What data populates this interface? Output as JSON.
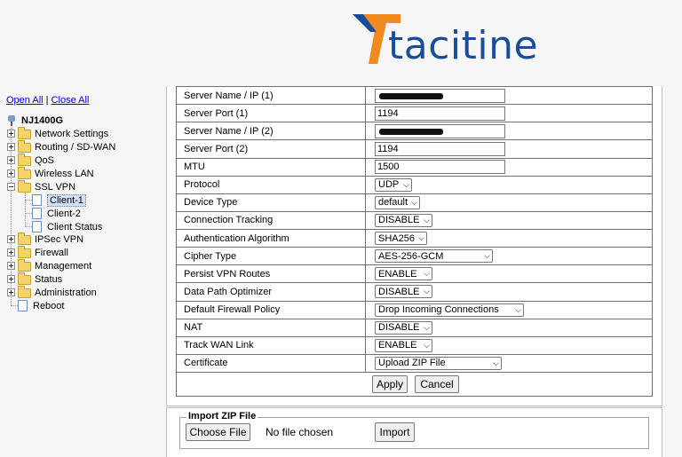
{
  "brand": {
    "name": "tacitine",
    "colors": {
      "orange": "#f08a1e",
      "blue": "#1a4d99"
    }
  },
  "sidebar": {
    "open_all": "Open All",
    "separator": "|",
    "close_all": "Close All",
    "root": "NJ1400G",
    "items": [
      {
        "label": "Network Settings"
      },
      {
        "label": "Routing / SD-WAN"
      },
      {
        "label": "QoS"
      },
      {
        "label": "Wireless LAN"
      },
      {
        "label": "SSL VPN"
      },
      {
        "label": "Client-1"
      },
      {
        "label": "Client-2"
      },
      {
        "label": "Client Status"
      },
      {
        "label": "IPSec VPN"
      },
      {
        "label": "Firewall"
      },
      {
        "label": "Management"
      },
      {
        "label": "Status"
      },
      {
        "label": "Administration"
      },
      {
        "label": "Reboot"
      }
    ]
  },
  "form": {
    "rows": [
      {
        "label": "Server Name / IP (1)",
        "value": ""
      },
      {
        "label": "Server Port (1)",
        "value": "1194"
      },
      {
        "label": "Server Name / IP (2)",
        "value": ""
      },
      {
        "label": "Server Port (2)",
        "value": "1194"
      },
      {
        "label": "MTU",
        "value": "1500"
      },
      {
        "label": "Protocol",
        "value": "UDP"
      },
      {
        "label": "Device Type",
        "value": "default"
      },
      {
        "label": "Connection Tracking",
        "value": "DISABLE"
      },
      {
        "label": "Authentication Algorithm",
        "value": "SHA256"
      },
      {
        "label": "Cipher Type",
        "value": "AES-256-GCM"
      },
      {
        "label": "Persist VPN Routes",
        "value": "ENABLE"
      },
      {
        "label": "Data Path Optimizer",
        "value": "DISABLE"
      },
      {
        "label": "Default Firewall Policy",
        "value": "Drop Incoming Connections"
      },
      {
        "label": "NAT",
        "value": "DISABLE"
      },
      {
        "label": "Track WAN Link",
        "value": "ENABLE"
      },
      {
        "label": "Certificate",
        "value": "Upload ZIP File"
      }
    ],
    "apply_label": "Apply",
    "cancel_label": "Cancel"
  },
  "import": {
    "legend": "Import ZIP File",
    "choose_label": "Choose File",
    "no_file_text": "No file chosen",
    "import_label": "Import"
  }
}
